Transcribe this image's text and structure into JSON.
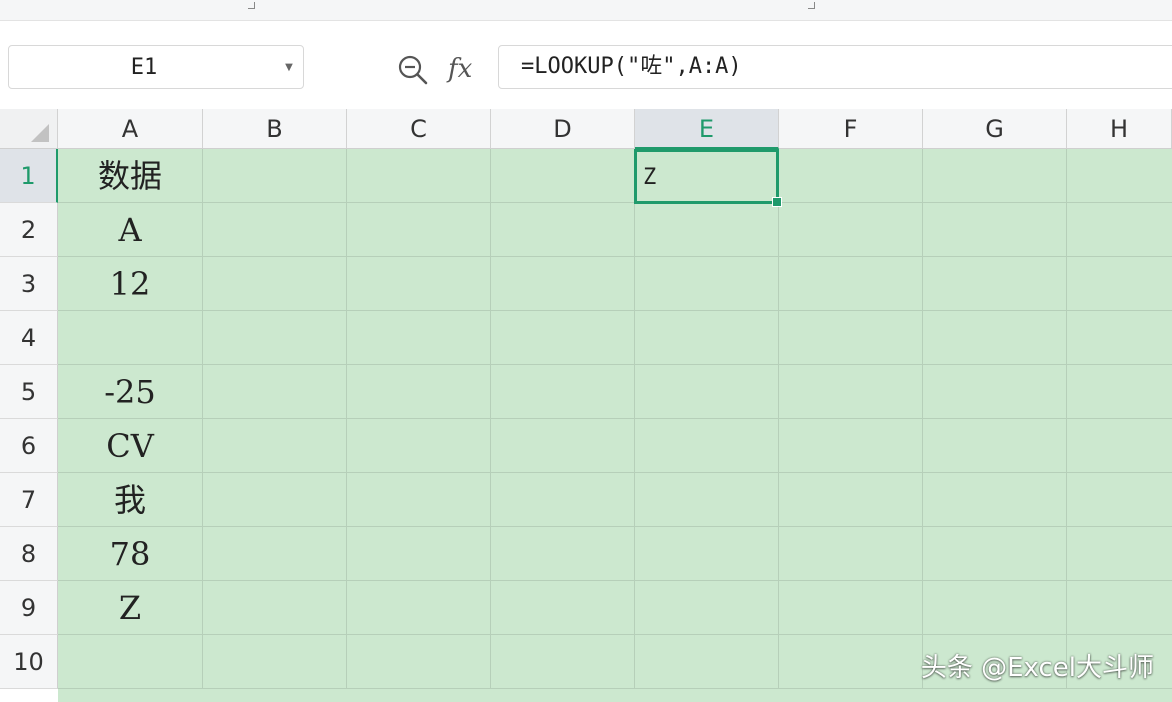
{
  "formula_bar": {
    "name_box": "E1",
    "fx_label": "fx",
    "formula": "=LOOKUP(\"咗\",A:A)"
  },
  "columns": [
    "A",
    "B",
    "C",
    "D",
    "E",
    "F",
    "G",
    "H"
  ],
  "rows": [
    "1",
    "2",
    "3",
    "4",
    "5",
    "6",
    "7",
    "8",
    "9",
    "10"
  ],
  "column_a_values": [
    "数据",
    "A",
    "12",
    "",
    "-25",
    "CV",
    "我",
    "78",
    "Z",
    ""
  ],
  "selected_cell": {
    "ref": "E1",
    "value": "Z"
  },
  "watermark": "头条 @Excel大斗师",
  "icons": {
    "zoom": "zoom-formula-icon",
    "dropdown": "chevron-down-icon"
  },
  "colors": {
    "sheet_background": "#cce8cf",
    "accent": "#1f9a6b"
  }
}
